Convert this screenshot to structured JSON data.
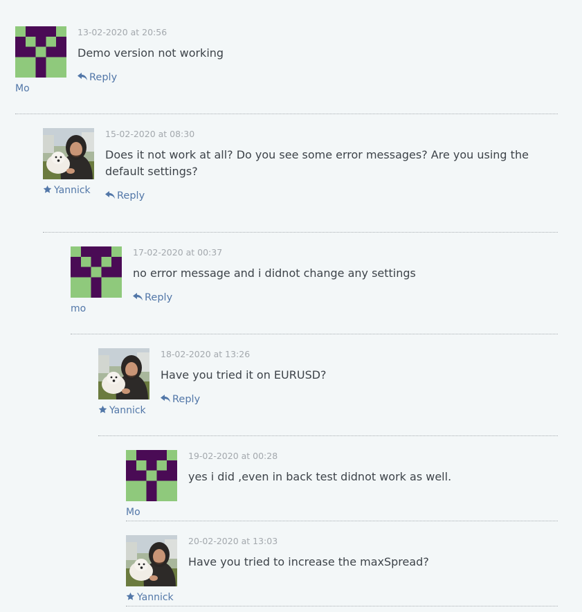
{
  "comments": [
    {
      "author": "Mo",
      "date": "13-02-2020 at 20:56",
      "text": "Demo version not working",
      "reply_label": "Reply",
      "avatar": "pixel-invader-icon",
      "is_admin": false
    },
    {
      "author": "Yannick",
      "date": "15-02-2020 at 08:30",
      "text": "Does it not work at all? Do you see some error messages? Are you using the default settings?",
      "reply_label": "Reply",
      "avatar": "user-photo",
      "is_admin": true
    },
    {
      "author": "mo",
      "date": "17-02-2020 at 00:37",
      "text": "no error message and i didnot change any settings",
      "reply_label": "Reply",
      "avatar": "pixel-invader-icon",
      "is_admin": false
    },
    {
      "author": "Yannick",
      "date": "18-02-2020 at 13:26",
      "text": "Have you tried it on EURUSD?",
      "reply_label": "Reply",
      "avatar": "user-photo",
      "is_admin": true
    },
    {
      "author": "Mo",
      "date": "19-02-2020 at 00:28",
      "text": "yes i did ,even in back test didnot work as well.",
      "reply_label": "",
      "avatar": "pixel-invader-icon",
      "is_admin": false
    },
    {
      "author": "Yannick",
      "date": "20-02-2020 at 13:03",
      "text": "Have you tried to increase the maxSpread?",
      "reply_label": "",
      "avatar": "user-photo",
      "is_admin": true
    }
  ],
  "colors": {
    "background": "#f3f7f8",
    "link": "#5277a8",
    "text": "#3d4349",
    "meta": "#a3a8ad",
    "identicon_bg": "#4a0b55",
    "identicon_fg": "#8fc97c"
  }
}
